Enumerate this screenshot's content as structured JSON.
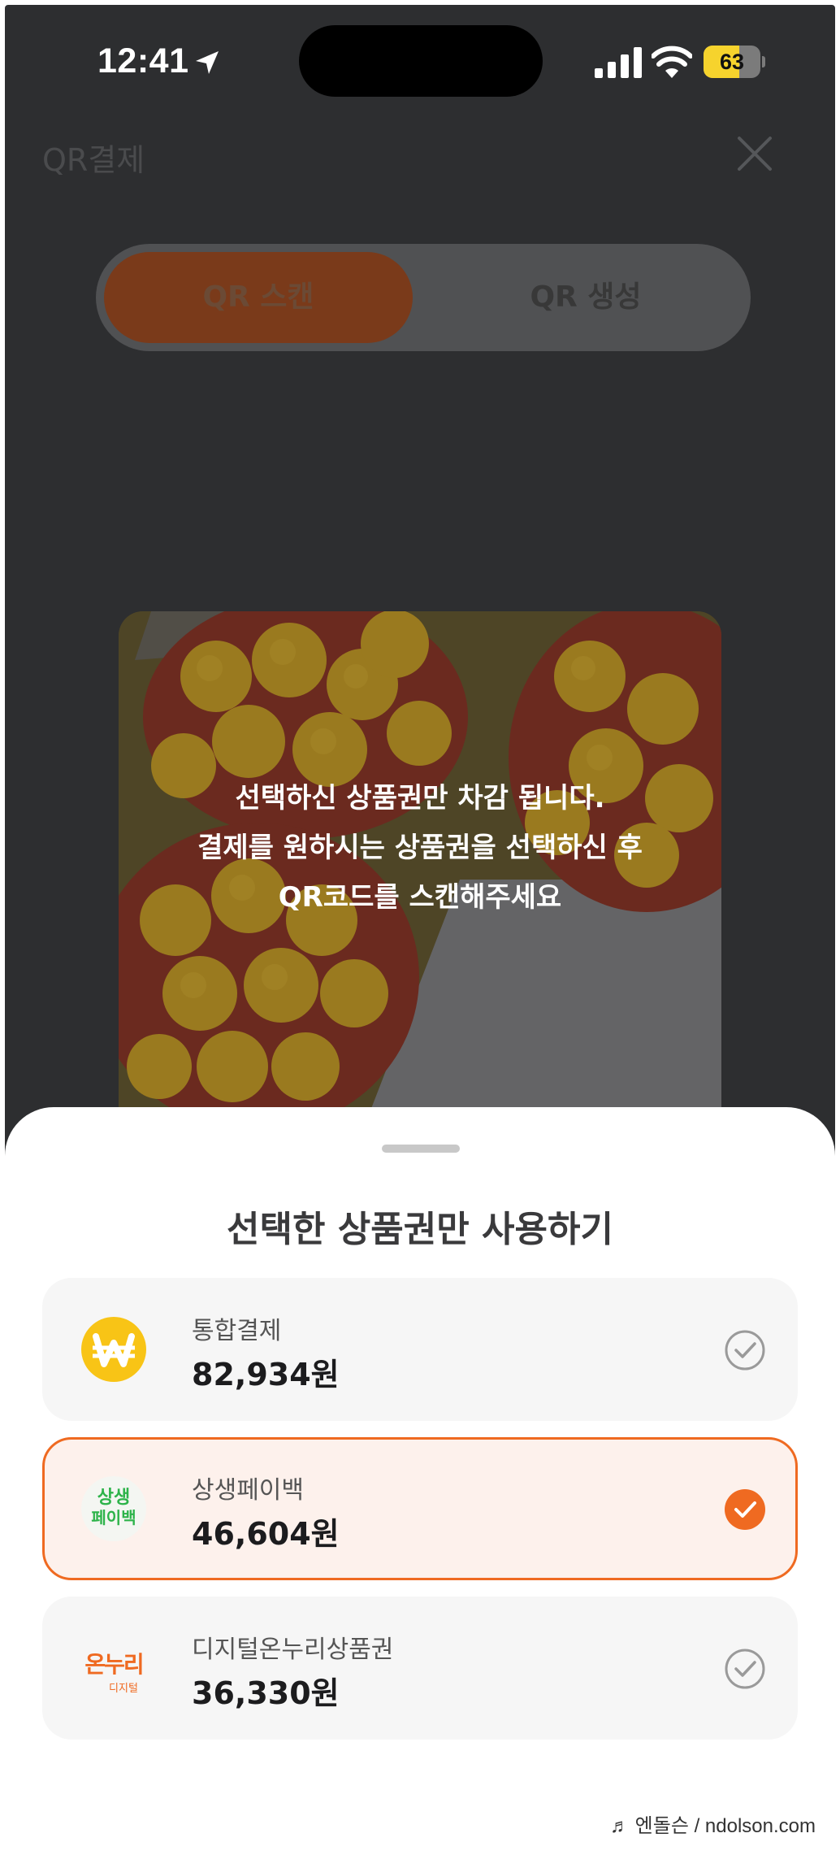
{
  "status_bar": {
    "time": "12:41",
    "battery": "63",
    "battery_level": 0.63
  },
  "header": {
    "title": "QR결제"
  },
  "tabs": [
    {
      "label": "QR 스캔",
      "active": true
    },
    {
      "label": "QR 생성",
      "active": false
    }
  ],
  "scanner": {
    "message_line1": "선택하신 상품권만 차감 됩니다.",
    "message_line2": "결제를 원하시는 상품권을 선택하신 후",
    "message_line3": "QR코드를 스캔해주세요"
  },
  "sheet": {
    "title": "선택한 상품권만 사용하기",
    "vouchers": [
      {
        "name": "통합결제",
        "amount": "82,934원",
        "selected": false,
        "icon": "won-coin-icon"
      },
      {
        "name": "상생페이백",
        "amount": "46,604원",
        "selected": true,
        "icon": "sangsaeng-paybag-logo",
        "logo_line1": "상생",
        "logo_line2": "페이백"
      },
      {
        "name": "디지털온누리상품권",
        "amount": "36,330원",
        "selected": false,
        "icon": "onnuri-logo",
        "logo_text": "온누리",
        "logo_sub": "디지털"
      }
    ]
  },
  "watermark": "♬ 엔돌슨 / ndolson.com",
  "colors": {
    "accent": "#ef6a21",
    "coin": "#f8c416",
    "paybag_green": "#2db34a",
    "onnuri_orange": "#ef6a21"
  }
}
